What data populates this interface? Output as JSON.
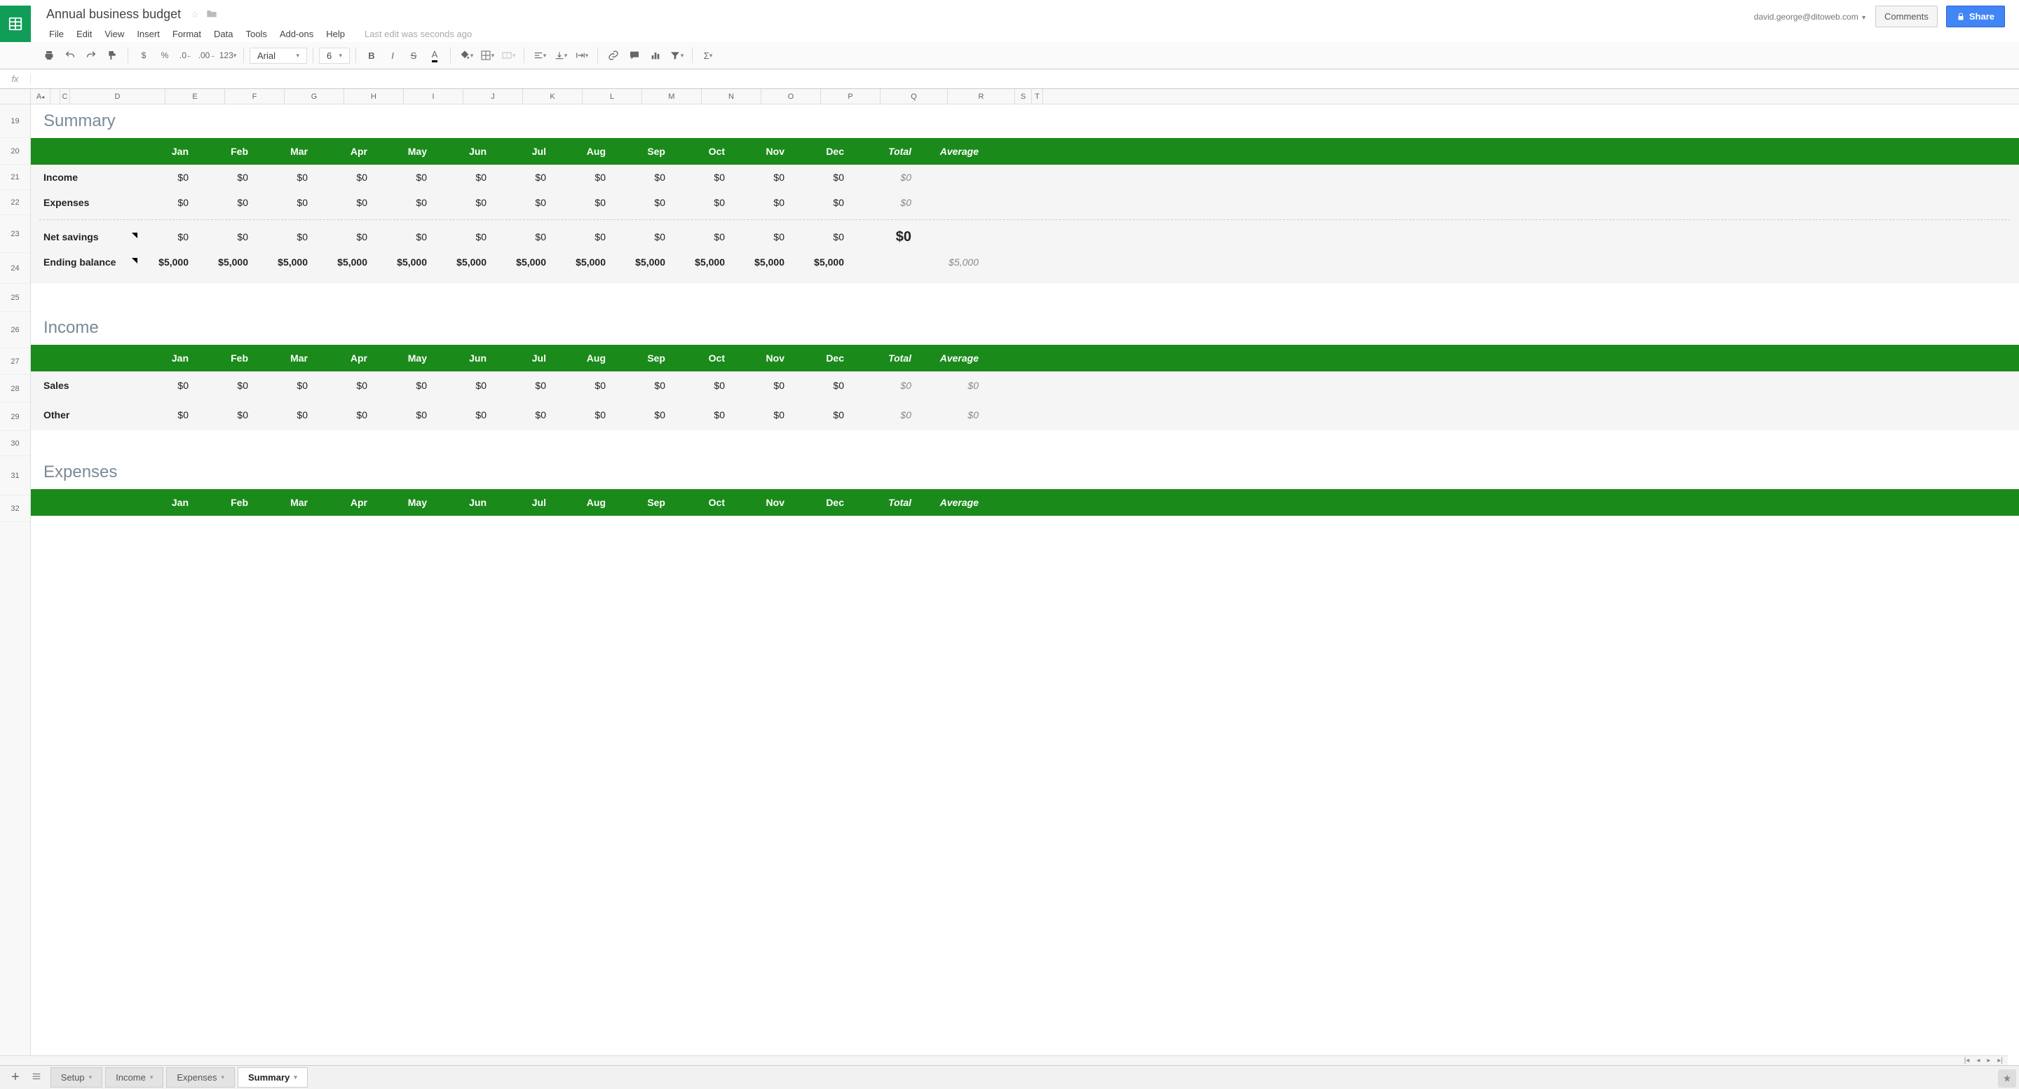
{
  "header": {
    "title": "Annual business budget",
    "user_email": "david.george@ditoweb.com",
    "comments_label": "Comments",
    "share_label": "Share",
    "last_edit": "Last edit was seconds ago"
  },
  "menu": [
    "File",
    "Edit",
    "View",
    "Insert",
    "Format",
    "Data",
    "Tools",
    "Add-ons",
    "Help"
  ],
  "toolbar": {
    "font": "Arial",
    "size": "6",
    "num_format": "123"
  },
  "columns": [
    {
      "l": "A",
      "w": 28
    },
    {
      "l": "",
      "w": 14
    },
    {
      "l": "C",
      "w": 14
    },
    {
      "l": "D",
      "w": 136
    },
    {
      "l": "E",
      "w": 85
    },
    {
      "l": "F",
      "w": 85
    },
    {
      "l": "G",
      "w": 85
    },
    {
      "l": "H",
      "w": 85
    },
    {
      "l": "I",
      "w": 85
    },
    {
      "l": "J",
      "w": 85
    },
    {
      "l": "K",
      "w": 85
    },
    {
      "l": "L",
      "w": 85
    },
    {
      "l": "M",
      "w": 85
    },
    {
      "l": "N",
      "w": 85
    },
    {
      "l": "O",
      "w": 85
    },
    {
      "l": "P",
      "w": 85
    },
    {
      "l": "Q",
      "w": 96
    },
    {
      "l": "R",
      "w": 96
    },
    {
      "l": "S",
      "w": 24
    },
    {
      "l": "T",
      "w": 16
    }
  ],
  "rows": [
    "19",
    "20",
    "21",
    "22",
    "23",
    "24",
    "25",
    "26",
    "27",
    "28",
    "29",
    "30",
    "31",
    "32"
  ],
  "months": [
    "Jan",
    "Feb",
    "Mar",
    "Apr",
    "May",
    "Jun",
    "Jul",
    "Aug",
    "Sep",
    "Oct",
    "Nov",
    "Dec"
  ],
  "total_label": "Total",
  "average_label": "Average",
  "sections": {
    "summary": {
      "title": "Summary",
      "rows": [
        {
          "label": "Income",
          "vals": [
            "$0",
            "$0",
            "$0",
            "$0",
            "$0",
            "$0",
            "$0",
            "$0",
            "$0",
            "$0",
            "$0",
            "$0"
          ],
          "total": "$0",
          "avg": ""
        },
        {
          "label": "Expenses",
          "vals": [
            "$0",
            "$0",
            "$0",
            "$0",
            "$0",
            "$0",
            "$0",
            "$0",
            "$0",
            "$0",
            "$0",
            "$0"
          ],
          "total": "$0",
          "avg": ""
        }
      ],
      "net": {
        "label": "Net savings",
        "vals": [
          "$0",
          "$0",
          "$0",
          "$0",
          "$0",
          "$0",
          "$0",
          "$0",
          "$0",
          "$0",
          "$0",
          "$0"
        ],
        "total": "$0",
        "avg": "",
        "note": true
      },
      "ending": {
        "label": "Ending balance",
        "vals": [
          "$5,000",
          "$5,000",
          "$5,000",
          "$5,000",
          "$5,000",
          "$5,000",
          "$5,000",
          "$5,000",
          "$5,000",
          "$5,000",
          "$5,000",
          "$5,000"
        ],
        "total": "",
        "avg": "$5,000",
        "note": true
      }
    },
    "income": {
      "title": "Income",
      "rows": [
        {
          "label": "Sales",
          "vals": [
            "$0",
            "$0",
            "$0",
            "$0",
            "$0",
            "$0",
            "$0",
            "$0",
            "$0",
            "$0",
            "$0",
            "$0"
          ],
          "total": "$0",
          "avg": "$0"
        },
        {
          "label": "Other",
          "vals": [
            "$0",
            "$0",
            "$0",
            "$0",
            "$0",
            "$0",
            "$0",
            "$0",
            "$0",
            "$0",
            "$0",
            "$0"
          ],
          "total": "$0",
          "avg": "$0"
        }
      ]
    },
    "expenses": {
      "title": "Expenses"
    }
  },
  "tabs": [
    "Setup",
    "Income",
    "Expenses",
    "Summary"
  ],
  "active_tab": "Summary"
}
